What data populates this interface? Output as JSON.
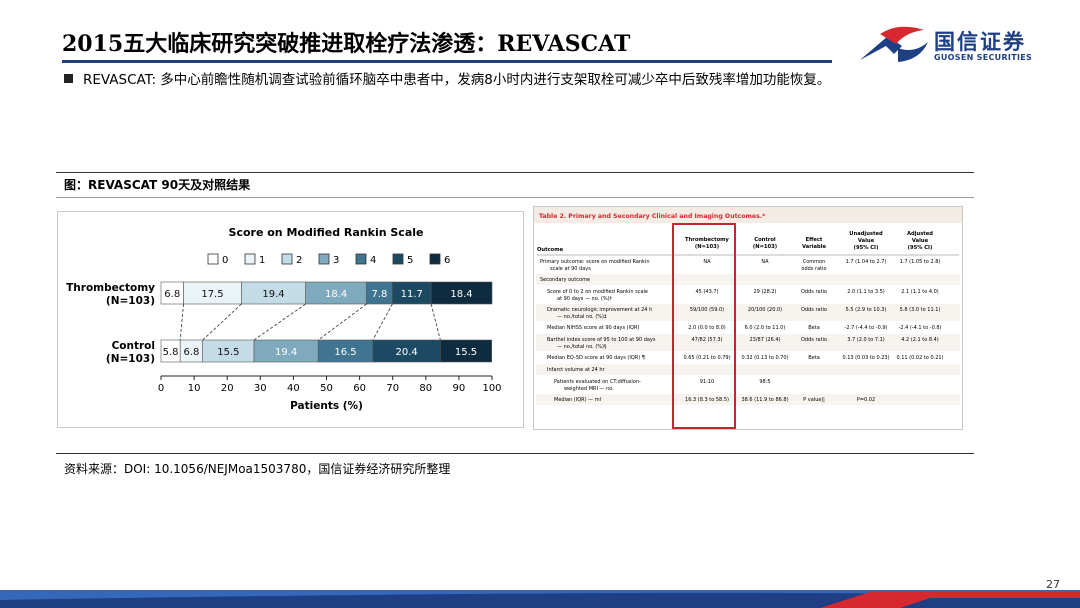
{
  "header": {
    "title": "2015五大临床研究突破推进取栓疗法渗透：REVASCAT",
    "logo_cn": "国信证券",
    "logo_en": "GUOSEN SECURITIES"
  },
  "bullet": "REVASCAT: 多中心前瞻性随机调查试验前循环脑卒中患者中，发病8小时内进行支架取栓可减少卒中后致残率增加功能恢复。",
  "figure_caption": "图：REVASCAT 90天及对照结果",
  "chart_data": {
    "type": "bar",
    "orientation": "horizontal-stacked",
    "title": "Score on Modified Rankin Scale",
    "xlabel": "Patients (%)",
    "xlim": [
      0,
      100
    ],
    "xticks": [
      "0",
      "10",
      "20",
      "30",
      "40",
      "50",
      "60",
      "70",
      "80",
      "90",
      "100"
    ],
    "legend": [
      "0",
      "1",
      "2",
      "3",
      "4",
      "5",
      "6"
    ],
    "legend_position": "top",
    "colors": [
      "#ffffff",
      "#eaf3f7",
      "#c4dce8",
      "#7fa9bd",
      "#3f7590",
      "#1d4a63",
      "#0e2b3f"
    ],
    "categories": [
      {
        "name": "Thrombectomy",
        "n": "(N=103)"
      },
      {
        "name": "Control",
        "n": "(N=103)"
      }
    ],
    "series": [
      {
        "name": "0",
        "values": [
          6.8,
          5.8
        ]
      },
      {
        "name": "1",
        "values": [
          17.5,
          6.8
        ]
      },
      {
        "name": "2",
        "values": [
          19.4,
          15.5
        ]
      },
      {
        "name": "3",
        "values": [
          18.4,
          19.4
        ]
      },
      {
        "name": "4",
        "values": [
          7.8,
          16.5
        ]
      },
      {
        "name": "5",
        "values": [
          11.7,
          20.4
        ]
      },
      {
        "name": "6",
        "values": [
          18.4,
          15.5
        ]
      }
    ]
  },
  "table2": {
    "title": "Table 2. Primary and Secondary Clinical and Imaging Outcomes.*",
    "columns": [
      {
        "line1": "Outcome",
        "line2": "",
        "line3": ""
      },
      {
        "line1": "Thrombectomy",
        "line2": "(N=103)",
        "line3": ""
      },
      {
        "line1": "Control",
        "line2": "(N=103)",
        "line3": ""
      },
      {
        "line1": "Effect",
        "line2": "Variable",
        "line3": ""
      },
      {
        "line1": "Unadjusted",
        "line2": "Value",
        "line3": "(95% CI)"
      },
      {
        "line1": "Adjusted",
        "line2": "Value",
        "line3": "(95% CI)"
      }
    ],
    "rows": [
      {
        "label": [
          "Primary outcome: score on modified Rankin",
          "scale at 90 days"
        ],
        "indent": 0,
        "cells": [
          "NA",
          "NA",
          "Common odds ratio",
          "1.7 (1.04 to 2.7)",
          "1.7 (1.05 to 2.8)"
        ]
      },
      {
        "label": [
          "Secondary outcome"
        ],
        "indent": 0,
        "cells": [
          "",
          "",
          "",
          "",
          ""
        ]
      },
      {
        "label": [
          "Score of 0 to 2 on modified Rankin scale",
          "at 90 days — no. (%)†"
        ],
        "indent": 1,
        "cells": [
          "45 (43.7)",
          "29 (28.2)",
          "Odds ratio",
          "2.0 (1.1 to 3.5)",
          "2.1 (1.1 to 4.0)"
        ]
      },
      {
        "label": [
          "Dramatic neurologic improvement at 24 h",
          "— no./total no. (%)‡"
        ],
        "indent": 1,
        "cells": [
          "59/100 (59.0)",
          "20/100 (20.0)",
          "Odds ratio",
          "5.5 (2.9 to 10.3)",
          "5.8 (3.0 to 11.1)"
        ]
      },
      {
        "label": [
          "Median NIHSS score at 90 days (IQR)"
        ],
        "indent": 1,
        "cells": [
          "2.0 (0.0 to 8.0)",
          "6.0 (2.0 to 11.0)",
          "Beta",
          "-2.7 (-4.4 to -0.9)",
          "-2.4 (-4.1 to -0.8)"
        ]
      },
      {
        "label": [
          "Barthel index score of 95 to 100 at 90 days",
          "— no./total no. (%)§"
        ],
        "indent": 1,
        "cells": [
          "47/82 (57.3)",
          "23/87 (26.4)",
          "Odds ratio",
          "3.7 (2.0 to 7.1)",
          "4.2 (2.1 to 8.4)"
        ]
      },
      {
        "label": [
          "Median EQ-5D score at 90 days (IQR) ¶"
        ],
        "indent": 1,
        "cells": [
          "0.65 (0.21 to 0.79)",
          "0.32 (0.13 to 0.70)",
          "Beta",
          "0.13 (0.03 to 0.23)",
          "0.11 (0.02 to 0.21)"
        ]
      },
      {
        "label": [
          "Infarct volume at 24 hr"
        ],
        "indent": 1,
        "cells": [
          "",
          "",
          "",
          "",
          ""
        ]
      },
      {
        "label": [
          "Patients evaluated on CT:diffusion-",
          "weighted MRI — no."
        ],
        "indent": 2,
        "cells": [
          "91:10",
          "98:5",
          "",
          "",
          ""
        ]
      },
      {
        "label": [
          "Median (IQR) — ml"
        ],
        "indent": 2,
        "cells": [
          "16.3 (8.3 to 58.5)",
          "38.6 (11.9 to 86.8)",
          "P value||",
          "P=0.02",
          ""
        ]
      }
    ]
  },
  "source": "资料来源：DOI: 10.1056/NEJMoa1503780，国信证券经济研究所整理",
  "page_number": "27",
  "theme": {
    "navy": "#1f3f84",
    "red": "#d7282f",
    "highlight": "#c0282d"
  }
}
